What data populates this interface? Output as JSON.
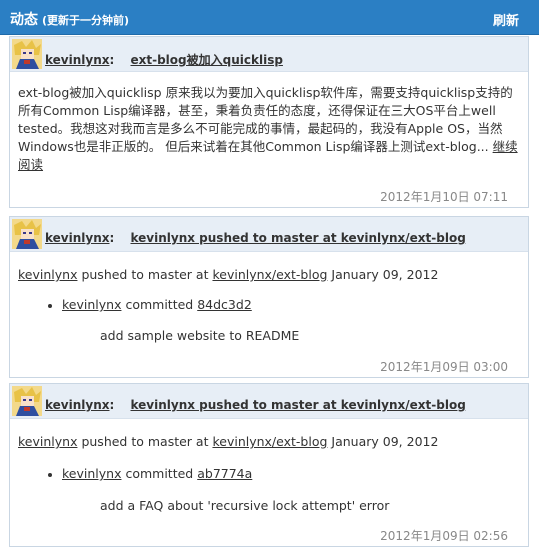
{
  "header": {
    "title": "动态",
    "subtitle": "(更新于一分钟前)",
    "refresh_label": "刷新"
  },
  "cards": [
    {
      "user": "kevinlynx",
      "headline": "ext-blog被加入quicklisp",
      "paragraph_lines": [
        "ext-blog被加入quicklisp 原来我以为要加入quicklisp软件库，需要支持quicklisp支持的",
        "所有Common Lisp编译器，甚至，秉着负责任的态度，还得保证在三大OS平台上well",
        "tested。我想这对我而言是多么不可能完成的事情，最起码的，我没有Apple OS，当然",
        "Windows也是非正版的。 但后来试着在其他Common Lisp编译器上测试ext-blog... "
      ],
      "read_more_1": "继续",
      "read_more_2": "阅读",
      "timestamp": "2012年1月10日 07:11"
    },
    {
      "user": "kevinlynx",
      "headline": "kevinlynx pushed to master at kevinlynx/ext-blog",
      "actor": "kevinlynx",
      "action": "pushed to master at",
      "repo": "kevinlynx/ext-blog",
      "date": "January 09, 2012",
      "committer": "kevinlynx",
      "committed_word": "committed",
      "commit_hash": "84dc3d2",
      "commit_message": "add sample website to README",
      "timestamp": "2012年1月09日 03:00"
    },
    {
      "user": "kevinlynx",
      "headline": "kevinlynx pushed to master at kevinlynx/ext-blog",
      "actor": "kevinlynx",
      "action": "pushed to master at",
      "repo": "kevinlynx/ext-blog",
      "date": "January 09, 2012",
      "committer": "kevinlynx",
      "committed_word": "committed",
      "commit_hash": "ab7774a",
      "commit_message": "add a FAQ about 'recursive lock attempt' error",
      "timestamp": "2012年1月09日 02:56"
    }
  ]
}
